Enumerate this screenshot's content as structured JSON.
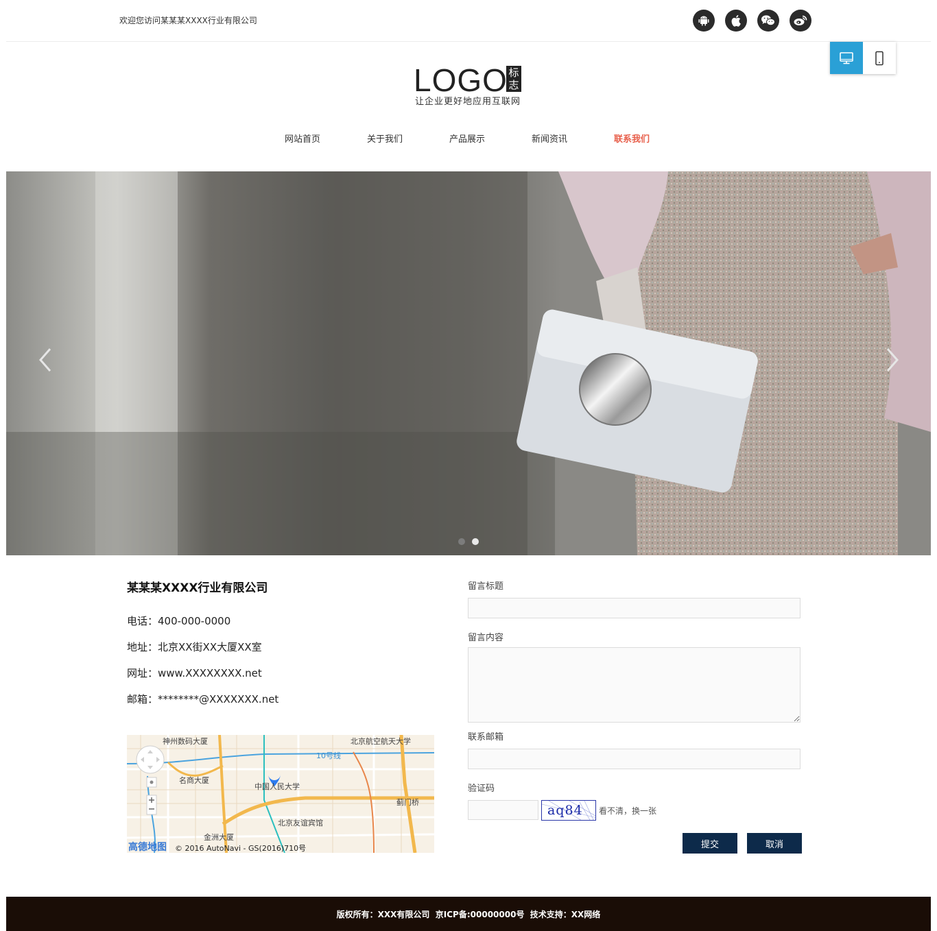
{
  "header": {
    "welcome": "欢迎您访问某某某XXXX行业有限公司",
    "social_icons": [
      "android-icon",
      "apple-icon",
      "wechat-icon",
      "weibo-icon"
    ],
    "device_modes": [
      "desktop-icon",
      "mobile-icon"
    ],
    "active_device": "desktop",
    "accent": "#2aa0d6"
  },
  "logo": {
    "text": "LOGO",
    "box_text": "标志",
    "slogan": "让企业更好地应用互联网"
  },
  "nav": {
    "items": [
      "网站首页",
      "关于我们",
      "产品展示",
      "新闻资讯",
      "联系我们"
    ],
    "active": "联系我们",
    "active_color": "#e8604c"
  },
  "banner": {
    "slide_count": 2,
    "active_slide": 2,
    "prev_icon": "chevron-left-icon",
    "next_icon": "chevron-right-icon"
  },
  "contact": {
    "company": "某某某XXXX行业有限公司",
    "phone": "电话：400-000-0000",
    "address": "地址：北京XX街XX大厦XX室",
    "website": "网址：www.XXXXXXXX.net",
    "email": "邮箱：********@XXXXXXX.net"
  },
  "map": {
    "labels": [
      "神州数码大厦",
      "北京航空航天大学",
      "10号线",
      "名商大厦",
      "中国人民大学",
      "蓟门桥",
      "北京友谊宾馆",
      "金洲大厦"
    ],
    "brand": "高德地图",
    "copyright": "© 2016 AutoNavi - GS(2016)710号"
  },
  "form": {
    "title_label": "留言标题",
    "content_label": "留言内容",
    "email_label": "联系邮箱",
    "captcha_label": "验证码",
    "captcha_text": "aq84",
    "refresh_text": "看不清，换一张",
    "submit": "提交",
    "cancel": "取消",
    "button_color": "#0d2a4a"
  },
  "footer": {
    "text": "版权所有：XXX有限公司  京ICP备:00000000号  技术支持：XX网络"
  }
}
